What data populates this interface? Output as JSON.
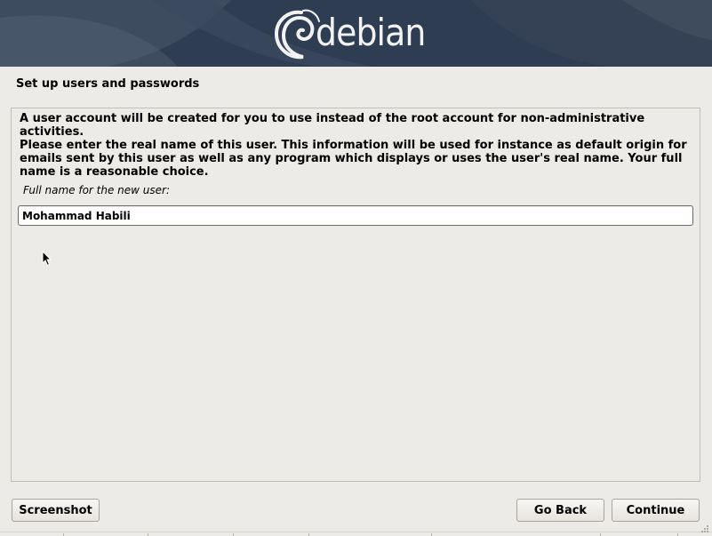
{
  "banner": {
    "logo_text": "debian",
    "logo_icon": "debian-swirl-icon"
  },
  "page": {
    "title": "Set up users and passwords"
  },
  "content": {
    "paragraph1": "A user account will be created for you to use instead of the root account for non-administrative activities.",
    "paragraph2": "Please enter the real name of this user. This information will be used for instance as default origin for emails sent by this user as well as any program which displays or uses the user's real name. Your full name is a reasonable choice.",
    "field_label": "Full name for the new user:",
    "fullname_value": "Mohammad Habili"
  },
  "buttons": {
    "screenshot": "Screenshot",
    "go_back": "Go Back",
    "continue": "Continue"
  },
  "colors": {
    "banner_bg": "#2f3d52",
    "window_bg": "#edebe7",
    "logo_text": "#f2f2f2"
  }
}
